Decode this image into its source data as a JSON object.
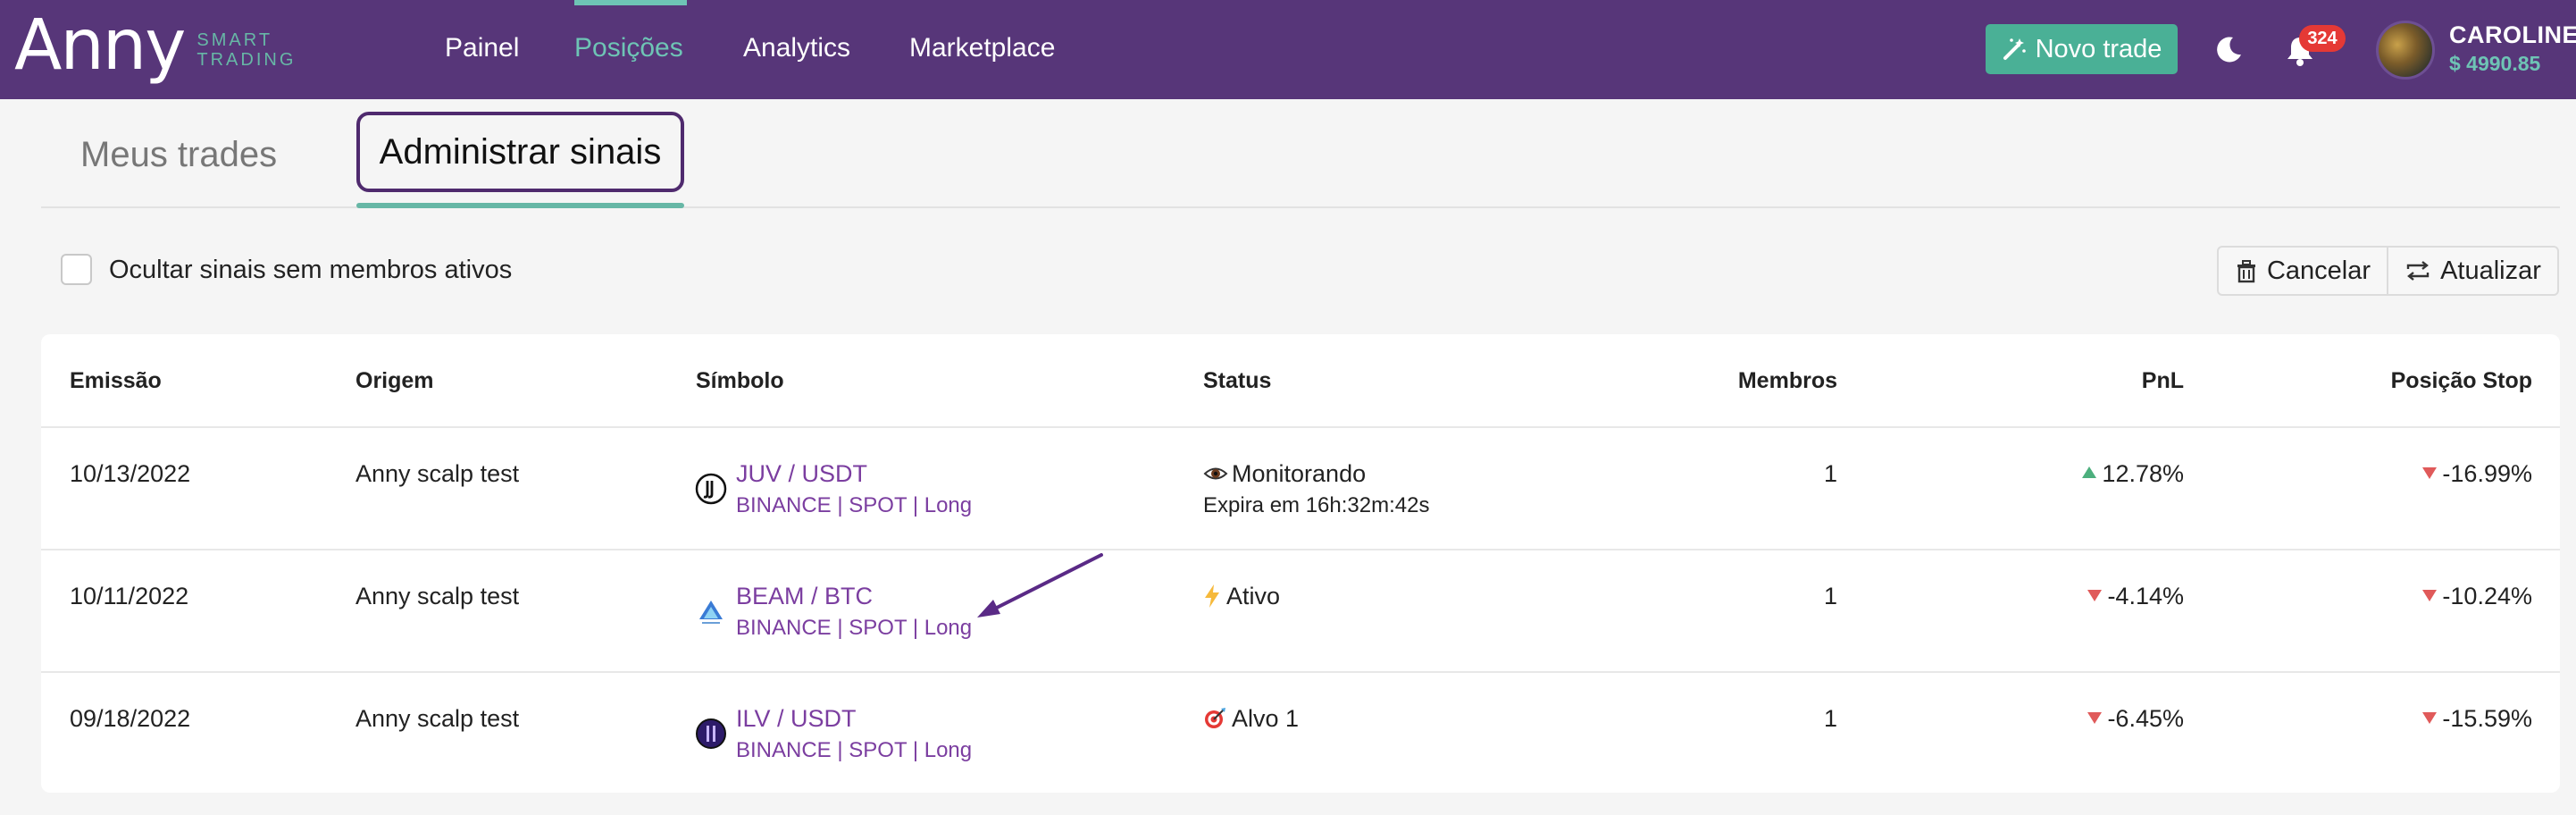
{
  "brand": {
    "logo_main": "Anny",
    "logo_sub_1": "SMART",
    "logo_sub_2": "TRADING"
  },
  "nav": {
    "items": [
      {
        "label": "Painel"
      },
      {
        "label": "Posições"
      },
      {
        "label": "Analytics"
      },
      {
        "label": "Marketplace"
      }
    ],
    "active": "Posições",
    "new_trade_label": "Novo trade",
    "notifications_count": "324",
    "user_name": "CAROLINE",
    "user_balance": "$ 4990.85"
  },
  "tabs": [
    {
      "label": "Meus trades"
    },
    {
      "label": "Administrar sinais"
    }
  ],
  "active_tab": "Administrar sinais",
  "filter": {
    "hide_inactive_label": "Ocultar sinais sem membros ativos",
    "checked": false
  },
  "actions": {
    "cancel_label": "Cancelar",
    "update_label": "Atualizar"
  },
  "table": {
    "headers": {
      "emissao": "Emissão",
      "origem": "Origem",
      "simbolo": "Símbolo",
      "status": "Status",
      "membros": "Membros",
      "pnl": "PnL",
      "posicao_stop": "Posição Stop"
    },
    "rows": [
      {
        "emissao": "10/13/2022",
        "origem": "Anny scalp test",
        "pair": "JUV / USDT",
        "meta": "BINANCE | SPOT | Long",
        "status_icon": "eye-icon",
        "status": "Monitorando",
        "status_sub": "Expira em 16h:32m:42s",
        "membros": "1",
        "pnl": "12.78%",
        "pnl_dir": "up",
        "stop": "-16.99%",
        "stop_dir": "down"
      },
      {
        "emissao": "10/11/2022",
        "origem": "Anny scalp test",
        "pair": "BEAM / BTC",
        "meta": "BINANCE | SPOT | Long",
        "status_icon": "lightning-icon",
        "status": "Ativo",
        "status_sub": "",
        "membros": "1",
        "pnl": "-4.14%",
        "pnl_dir": "down",
        "stop": "-10.24%",
        "stop_dir": "down"
      },
      {
        "emissao": "09/18/2022",
        "origem": "Anny scalp test",
        "pair": "ILV / USDT",
        "meta": "BINANCE | SPOT | Long",
        "status_icon": "target-icon",
        "status": "Alvo 1",
        "status_sub": "",
        "membros": "1",
        "pnl": "-6.45%",
        "pnl_dir": "down",
        "stop": "-15.59%",
        "stop_dir": "down"
      }
    ]
  },
  "colors": {
    "navbar": "#573679",
    "accent": "#4ab096",
    "link": "#7b3ea0",
    "up": "#4caf7d",
    "down": "#e05a5a"
  }
}
